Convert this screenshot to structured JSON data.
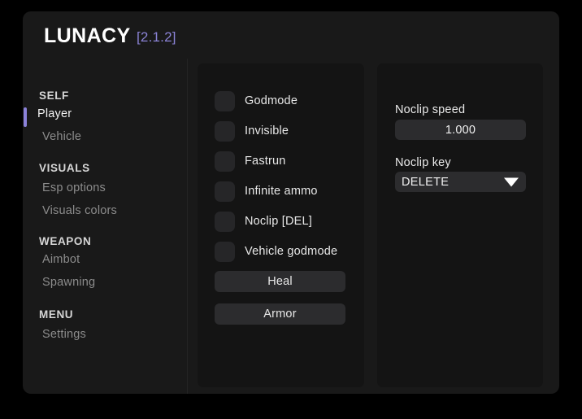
{
  "app": {
    "title": "LUNACY",
    "version": "[2.1.2]",
    "accent_color": "#8b82d9",
    "window_background": "#191919",
    "panel_background": "#141414",
    "control_background": "#2c2c2e",
    "checkbox_background": "#262628"
  },
  "sidebar": {
    "sections": [
      {
        "header": "SELF",
        "items": [
          {
            "label": "Player",
            "active": true
          },
          {
            "label": "Vehicle",
            "active": false
          }
        ]
      },
      {
        "header": "VISUALS",
        "items": [
          {
            "label": "Esp options",
            "active": false
          },
          {
            "label": "Visuals colors",
            "active": false
          }
        ]
      },
      {
        "header": "WEAPON",
        "items": [
          {
            "label": "Aimbot",
            "active": false
          },
          {
            "label": "Spawning",
            "active": false
          }
        ]
      },
      {
        "header": "MENU",
        "items": [
          {
            "label": "Settings",
            "active": false
          }
        ]
      }
    ]
  },
  "toggles_panel": {
    "checkboxes": [
      {
        "label": "Godmode",
        "checked": false
      },
      {
        "label": "Invisible",
        "checked": false
      },
      {
        "label": "Fastrun",
        "checked": false
      },
      {
        "label": "Infinite ammo",
        "checked": false
      },
      {
        "label": "Noclip [DEL]",
        "checked": false
      },
      {
        "label": "Vehicle godmode",
        "checked": false
      }
    ],
    "buttons": [
      {
        "label": "Heal"
      },
      {
        "label": "Armor"
      }
    ]
  },
  "settings_panel": {
    "noclip_speed": {
      "label": "Noclip speed",
      "value": "1.000",
      "placeholder": "1.000"
    },
    "noclip_key": {
      "label": "Noclip key",
      "value": "DELETE",
      "arrow_icon": "chevron-down-icon"
    }
  }
}
